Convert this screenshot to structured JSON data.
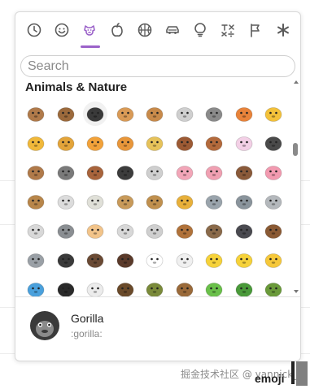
{
  "categories": [
    {
      "name": "recent",
      "icon": "clock-icon",
      "active": false
    },
    {
      "name": "smileys",
      "icon": "smiley-icon",
      "active": false
    },
    {
      "name": "animals",
      "icon": "dog-icon",
      "active": true
    },
    {
      "name": "food",
      "icon": "apple-icon",
      "active": false
    },
    {
      "name": "activity",
      "icon": "basketball-icon",
      "active": false
    },
    {
      "name": "travel",
      "icon": "car-icon",
      "active": false
    },
    {
      "name": "objects",
      "icon": "lightbulb-icon",
      "active": false
    },
    {
      "name": "symbols",
      "icon": "symbols-icon",
      "active": false
    },
    {
      "name": "flags",
      "icon": "flag-icon",
      "active": false
    },
    {
      "name": "custom",
      "icon": "asterisk-icon",
      "active": false
    }
  ],
  "colors": {
    "accent": "#9b62c9",
    "text": "#222222",
    "muted": "#8a8a8a",
    "border": "#d9d9d9"
  },
  "search": {
    "placeholder": "Search",
    "value": ""
  },
  "section": {
    "title": "Animals & Nature"
  },
  "emojis": [
    {
      "name": "monkey_face",
      "color": "#b07a4a"
    },
    {
      "name": "monkey",
      "color": "#9c6a3c"
    },
    {
      "name": "gorilla",
      "color": "#3a3a3a",
      "selected": true
    },
    {
      "name": "dog",
      "color": "#d99a56"
    },
    {
      "name": "dog2",
      "color": "#c88a4a"
    },
    {
      "name": "poodle",
      "color": "#cfcfcf"
    },
    {
      "name": "wolf",
      "color": "#8a8a8a"
    },
    {
      "name": "fox_face",
      "color": "#e8833a"
    },
    {
      "name": "cat",
      "color": "#f3c13a"
    },
    {
      "name": "cat2",
      "color": "#f0b83a"
    },
    {
      "name": "lion_face",
      "color": "#e3a43a"
    },
    {
      "name": "tiger",
      "color": "#f2a23a"
    },
    {
      "name": "tiger2",
      "color": "#e8963a"
    },
    {
      "name": "leopard",
      "color": "#e6c25a"
    },
    {
      "name": "horse",
      "color": "#9c5a34"
    },
    {
      "name": "racehorse",
      "color": "#b36a3c"
    },
    {
      "name": "unicorn",
      "color": "#f3d0e6"
    },
    {
      "name": "zebra",
      "color": "#4a4a4a"
    },
    {
      "name": "deer",
      "color": "#b07a4a"
    },
    {
      "name": "cow",
      "color": "#7a7a7a"
    },
    {
      "name": "ox",
      "color": "#a8643c"
    },
    {
      "name": "water_buffalo",
      "color": "#3c3c3c"
    },
    {
      "name": "cow2",
      "color": "#cfcfcf"
    },
    {
      "name": "pig",
      "color": "#f2a6b8"
    },
    {
      "name": "pig2",
      "color": "#f0a0b2"
    },
    {
      "name": "boar",
      "color": "#8a5a3a"
    },
    {
      "name": "pig_nose",
      "color": "#f29ab0"
    },
    {
      "name": "ram",
      "color": "#b8864a"
    },
    {
      "name": "sheep",
      "color": "#dcdcdc"
    },
    {
      "name": "goat",
      "color": "#e0e0d8"
    },
    {
      "name": "dromedary_camel",
      "color": "#c89a5a"
    },
    {
      "name": "camel",
      "color": "#c0904e"
    },
    {
      "name": "giraffe",
      "color": "#e8b03a"
    },
    {
      "name": "elephant",
      "color": "#9aa4ac"
    },
    {
      "name": "rhinoceros",
      "color": "#8a949c"
    },
    {
      "name": "mouse",
      "color": "#b4b8bc"
    },
    {
      "name": "mouse2",
      "color": "#d8d8d8"
    },
    {
      "name": "rat",
      "color": "#8a8e92"
    },
    {
      "name": "hamster",
      "color": "#f2c48a"
    },
    {
      "name": "rabbit",
      "color": "#d8d8d8"
    },
    {
      "name": "rabbit2",
      "color": "#cfcfcf"
    },
    {
      "name": "chipmunk",
      "color": "#b0723a"
    },
    {
      "name": "hedgehog",
      "color": "#8a6a4a"
    },
    {
      "name": "bat",
      "color": "#4a4a50"
    },
    {
      "name": "bear",
      "color": "#8a5a34"
    },
    {
      "name": "koala",
      "color": "#9aa0a6"
    },
    {
      "name": "panda_face",
      "color": "#3a3a3a"
    },
    {
      "name": "feet",
      "color": "#6a4a34"
    },
    {
      "name": "turkey",
      "color": "#5a3a2a"
    },
    {
      "name": "chicken",
      "color": "#ffffff"
    },
    {
      "name": "rooster",
      "color": "#f0f0f0"
    },
    {
      "name": "hatching_chick",
      "color": "#f6d23a"
    },
    {
      "name": "baby_chick",
      "color": "#f6d23a"
    },
    {
      "name": "hatched_chick",
      "color": "#f6c83a"
    },
    {
      "name": "bird",
      "color": "#4aa0dc"
    },
    {
      "name": "penguin",
      "color": "#2a2a2a"
    },
    {
      "name": "dove",
      "color": "#ececec"
    },
    {
      "name": "eagle",
      "color": "#6a4a2a"
    },
    {
      "name": "duck",
      "color": "#7a8a3a"
    },
    {
      "name": "owl",
      "color": "#9a6a3a"
    },
    {
      "name": "frog",
      "color": "#6ac04a"
    },
    {
      "name": "crocodile",
      "color": "#4a9a3a"
    },
    {
      "name": "turtle",
      "color": "#6a9a3a"
    }
  ],
  "preview": {
    "name": "Gorilla",
    "shortcode": ":gorilla:",
    "icon": "gorilla-icon"
  },
  "watermark": "掘金技术社区 @ yannick_li",
  "trigger": {
    "label": "emoji"
  }
}
